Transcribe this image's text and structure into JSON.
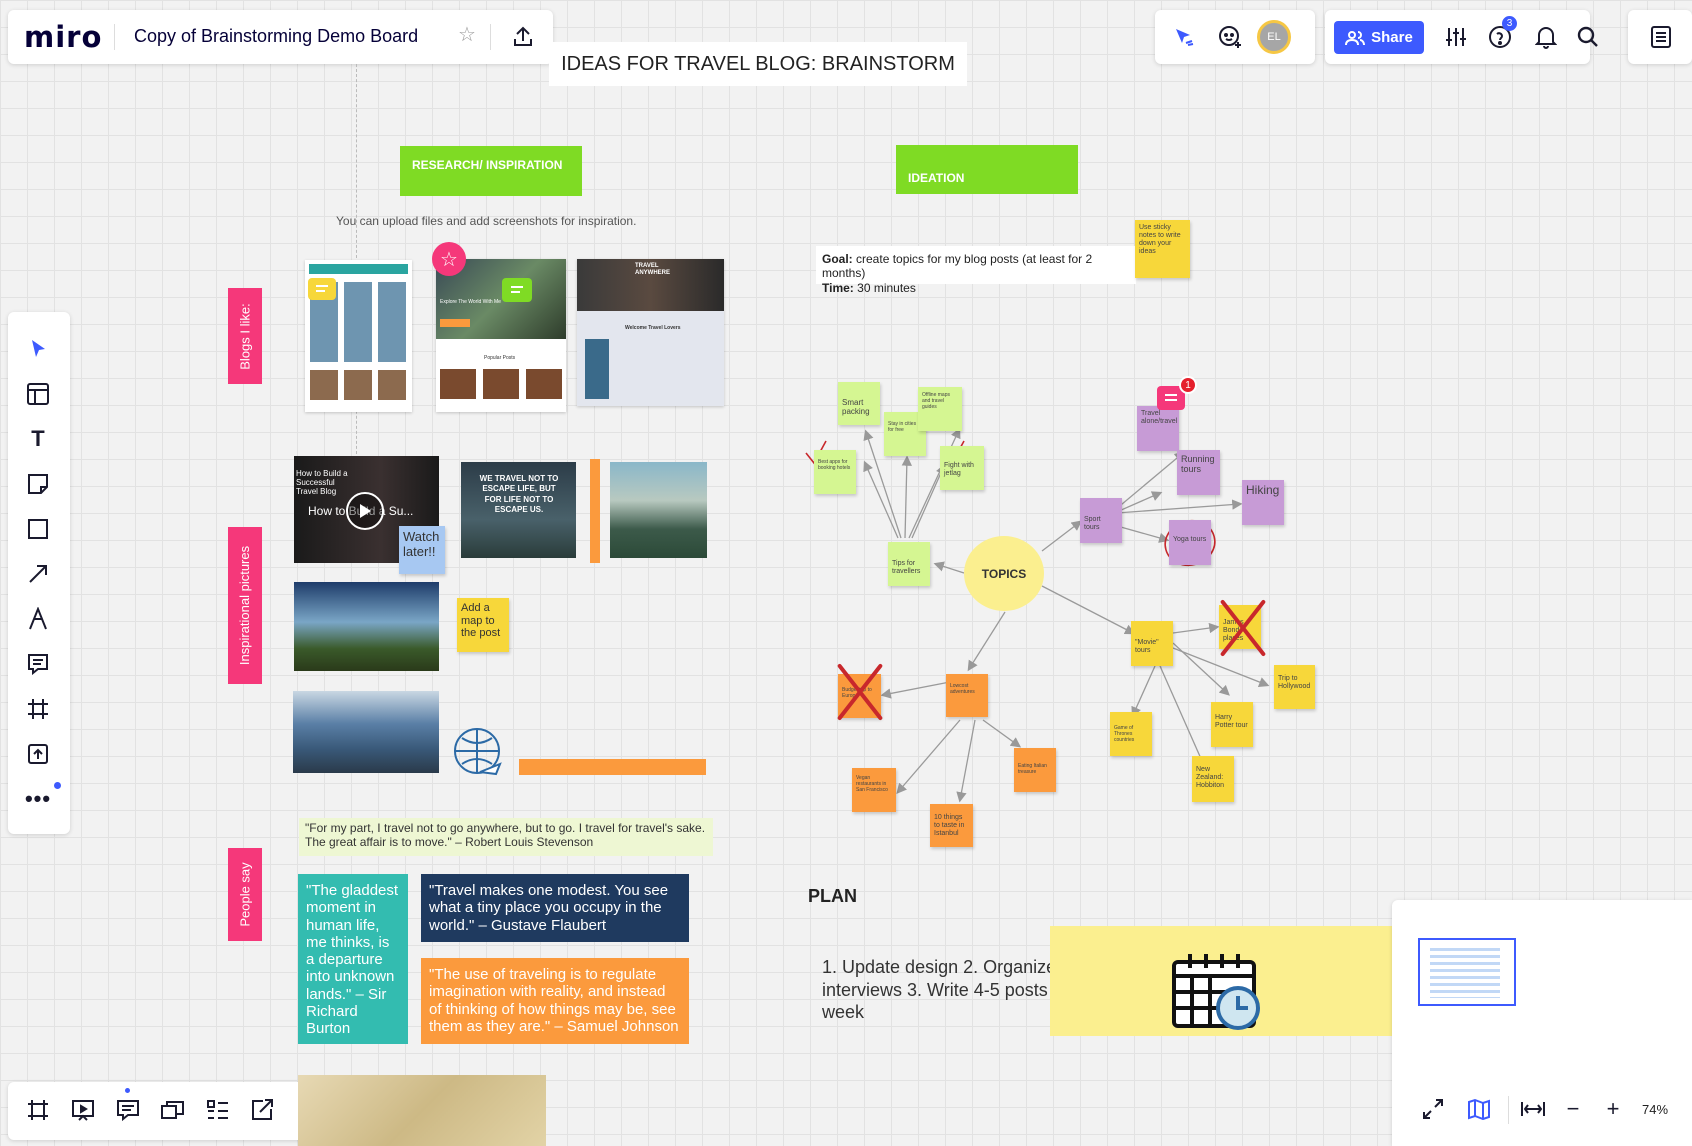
{
  "app": {
    "logo": "miro",
    "board_title": "Copy of Brainstorming Demo Board",
    "star_icon": "star-icon",
    "export_icon": "upload-icon"
  },
  "board_header": "IDEAS FOR TRAVEL BLOG: BRAINSTORM",
  "topbar": {
    "share_label": "Share",
    "avatar_initials": "EL",
    "help_badge": "3"
  },
  "sections": {
    "research_label": "RESEARCH/ INSPIRATION",
    "ideation_label": "IDEATION",
    "upload_note": "You can upload files and add screenshots for inspiration.",
    "blogs_label": "Blogs I like:",
    "pictures_label": "Inspirational pictures",
    "people_label": "People say"
  },
  "goal": {
    "goal_label": "Goal:",
    "goal_text": "create topics for my blog posts (at least for 2 months)",
    "time_label": "Time:",
    "time_text": "30 minutes"
  },
  "stickies": {
    "use_sticky": "Use sticky notes to write down your ideas",
    "watch_later": "Watch later!!",
    "add_map": "Add a map to the post",
    "video_title": "How to Build a Su...",
    "video_caption": "How to Build a Successful Travel Blog",
    "quote_img1": "WE TRAVEL NOT TO ESCAPE LIFE, BUT FOR LIFE NOT TO ESCAPE US.",
    "topics": "TOPICS",
    "tips": "Tips for travellers",
    "smart_packing": "Smart packing",
    "stay_in_cities": "Stay in cities for free",
    "offline_maps": "Offline maps and travel guides",
    "best_apps": "Best apps for booking hotels",
    "jetlag": "Fight with jetlag",
    "sport_tours": "Sport tours",
    "travel_alone": "Travel alone/travel",
    "running_tours": "Running tours",
    "hiking": "Hiking",
    "yoga": "Yoga tours",
    "movie_tours": "\"Movie\" tours",
    "james_bond": "James Bond places",
    "hollywood": "Trip to Hollywood",
    "harry_potter": "Harry Potter tour",
    "got": "Game of Thrones countries",
    "nz": "New Zealand: Hobbiton",
    "lowcost": "Lowcost adventures",
    "budget_trip": "Budget trip to Europe",
    "vegan": "Vegan restaurants in San Francisco",
    "ten_things": "10 things to taste in Istanbul",
    "italian": "Eating Italian treasure",
    "comment_badge": "1"
  },
  "quotes": {
    "stevenson": "\"For my part, I travel not to go anywhere, but to go. I travel for travel's sake. The great affair is to move.\" – Robert Louis Stevenson",
    "burton": "\"The gladdest moment in human life, me thinks, is a departure into unknown lands.\" – Sir Richard Burton",
    "flaubert": "\"Travel makes one modest. You see what a tiny place you occupy in the world.\" – Gustave Flaubert",
    "johnson": "\"The use of traveling is to regulate imagination with reality, and instead of thinking of how things may be, see them as they are.\" – Samuel Johnson"
  },
  "plan": {
    "title": "PLAN",
    "text": "1. Update design 2. Organize interviews 3. Write 4-5 posts a week"
  },
  "blog_shots": {
    "shot2_banner": "Explore The World With Me",
    "shot2_section": "Popular Posts",
    "shot3_title": "TRAVEL ANYWHERE",
    "shot3_section": "Welcome Travel Lovers"
  },
  "zoom": {
    "level": "74%"
  },
  "colors": {
    "accent_blue": "#3d5afe",
    "green_label": "#7fdb24",
    "pink_label": "#f5387a",
    "teal": "#33bcb0",
    "navy": "#1f3a5f",
    "orange": "#fb9a3d"
  }
}
